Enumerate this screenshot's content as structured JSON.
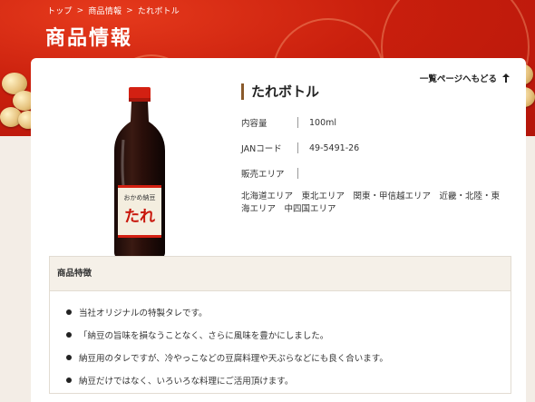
{
  "breadcrumb": {
    "items": [
      "トップ",
      "商品情報",
      "たれボトル"
    ],
    "separator": ">"
  },
  "page": {
    "title": "商品情報"
  },
  "nav": {
    "back_label": "一覧ページへもどる",
    "back_icon": "arrow-up-icon"
  },
  "product": {
    "name": "たれボトル",
    "label_text": "たれ",
    "label_brand": "おかめ納豆",
    "specs": [
      {
        "label": "内容量",
        "value": "100ml"
      },
      {
        "label": "JANコード",
        "value": "49-5491-26"
      },
      {
        "label": "販売エリア",
        "value": ""
      }
    ],
    "areas_text": "北海道エリア　東北エリア　関東・甲信越エリア　近畿・北陸・東海エリア　中四国エリア"
  },
  "features": {
    "heading": "商品特徴",
    "items": [
      "当社オリジナルの特製タレです。",
      "「納豆の旨味を損なうことなく、さらに風味を豊かにしました。",
      "納豆用のタレですが、冷やっこなどの豆腐料理や天ぷらなどにも良く合います。",
      "納豆だけではなく、いろいろな料理にご活用頂けます。"
    ]
  },
  "colors": {
    "brand_red": "#c91f0d",
    "accent_brown": "#8a5a2b",
    "card_bg": "#ffffff"
  }
}
